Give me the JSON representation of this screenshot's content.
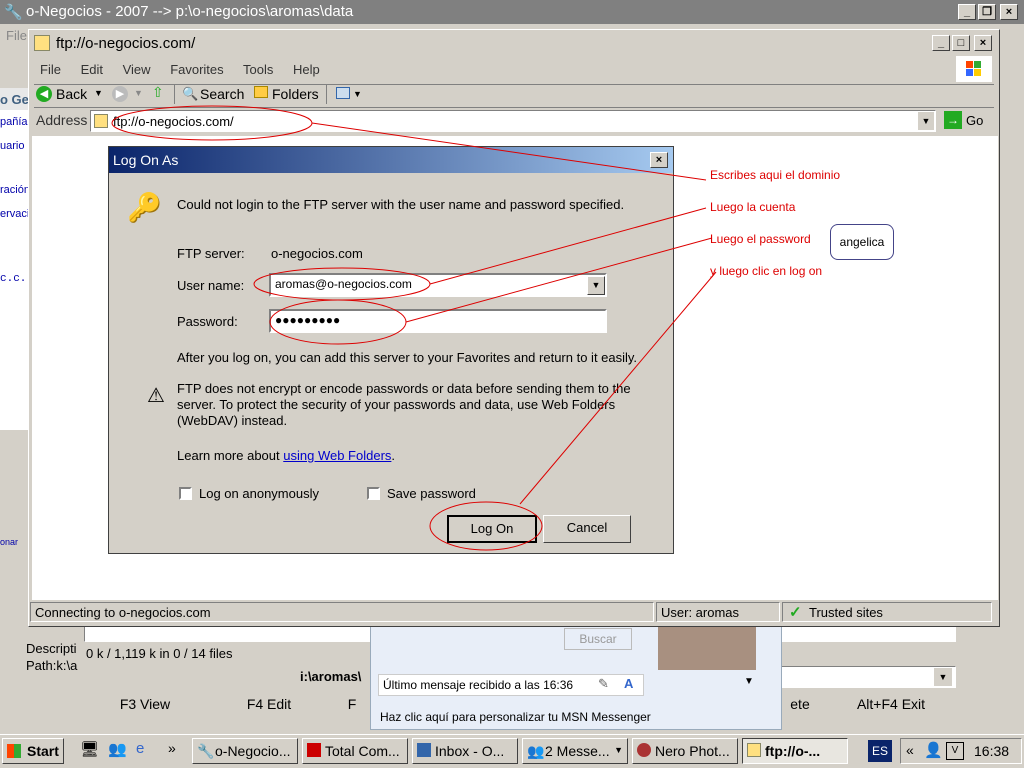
{
  "back_window": {
    "title": "o-Negocios - 2007 --> p:\\o-negocios\\aromas\\data",
    "menu_file": "File",
    "left_labels": [
      "o Ge",
      "pañía",
      "uario",
      "ración",
      "ervaci",
      "c.c."
    ],
    "descr": "Descripti",
    "path": "Path:k:\\a",
    "files_info": "0 k / 1,119 k in 0 / 14 files",
    "cmd_path": "i:\\aromas\\",
    "fkeys": [
      "F3 View",
      "F4 Edit",
      "F",
      "ete",
      "Alt+F4 Exit"
    ],
    "left_icon_label": "onar"
  },
  "messenger": {
    "search_btn": "Buscar",
    "last_msg": "Último mensaje recibido a las 16:36",
    "customize": "Haz clic aquí para personalizar tu MSN Messenger"
  },
  "ie": {
    "title": "ftp://o-negocios.com/",
    "menu": [
      "File",
      "Edit",
      "View",
      "Favorites",
      "Tools",
      "Help"
    ],
    "back": "Back",
    "search": "Search",
    "folders": "Folders",
    "address_label": "Address",
    "address_value": "ftp://o-negocios.com/",
    "go": "Go",
    "status_text": "Connecting to o-negocios.com",
    "status_user": "User: aromas",
    "status_zone": "Trusted sites"
  },
  "dialog": {
    "title": "Log On As",
    "message": "Could not login to the FTP server with the user name and password specified.",
    "ftp_label": "FTP server:",
    "ftp_value": "o-negocios.com",
    "user_label": "User name:",
    "user_value": "aromas@o-negocios.com",
    "pass_label": "Password:",
    "pass_value": "●●●●●●●●●",
    "after_text": "After you log on, you can add this server to your Favorites and return to it easily.",
    "warning": "FTP does not encrypt or encode passwords or data before sending them to the server.  To protect the security of your passwords and data, use Web Folders (WebDAV) instead.",
    "learn_prefix": "Learn more about",
    "learn_link": "using Web Folders",
    "learn_suffix": ".",
    "anon": "Log on anonymously",
    "save_pw": "Save password",
    "logon": "Log On",
    "cancel": "Cancel"
  },
  "annotations": {
    "domain": "Escribes aqui el dominio",
    "account": "Luego la cuenta",
    "password": "Luego el password",
    "click": "y luego clic en log on",
    "bubble": "angelica"
  },
  "taskbar": {
    "start": "Start",
    "items": [
      "o-Negocio...",
      "Total Com...",
      "Inbox - O...",
      "2 Messe...",
      "Nero Phot...",
      "ftp://o-..."
    ],
    "lang": "ES",
    "time": "16:38",
    "chevron": "»",
    "tray_chevron": "«"
  }
}
